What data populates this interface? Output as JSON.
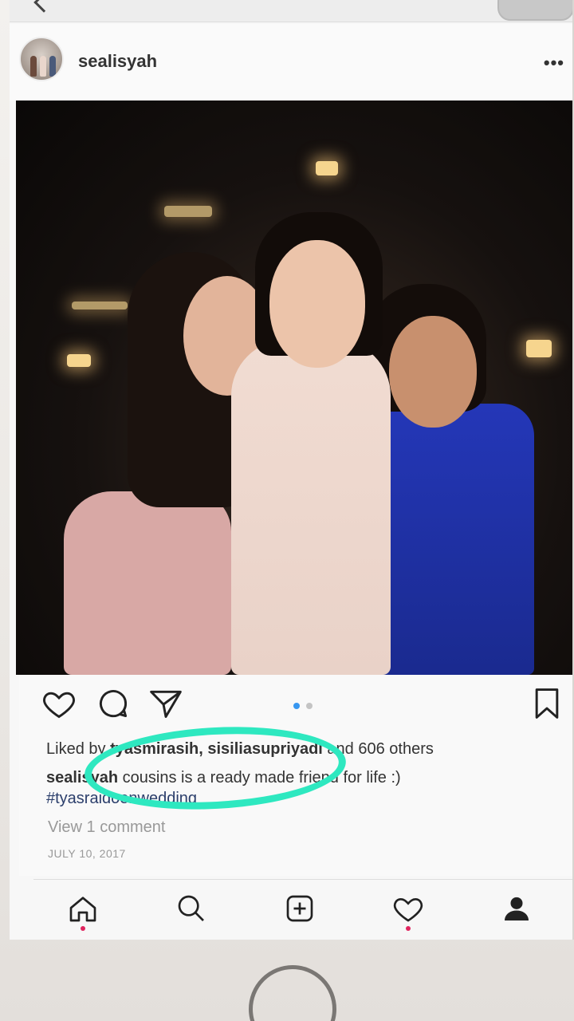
{
  "header": {
    "username": "sealisyah",
    "more_label": "•••"
  },
  "carousel": {
    "active_index": 0,
    "count": 2
  },
  "caption": {
    "likes_prefix": "Liked by ",
    "liked_users": "tyasmirasih, sisiliasupriyadi",
    "likes_suffix": " and 606 others",
    "author": "sealisyah",
    "text": " cousins is a ready made friend for life :)",
    "hashtag": "#tyasraidoenwedding",
    "view_comments": "View 1 comment",
    "date": "JULY 10, 2017"
  },
  "icons": {
    "like": "heart-icon",
    "comment": "comment-icon",
    "share": "send-icon",
    "save": "bookmark-icon",
    "home": "home-icon",
    "search": "search-icon",
    "new_post": "add-icon",
    "activity": "heart-icon",
    "profile": "profile-icon"
  },
  "colors": {
    "highlight": "#2ee8c0",
    "carousel_active": "#3897f0",
    "notification_dot": "#e0245e"
  }
}
